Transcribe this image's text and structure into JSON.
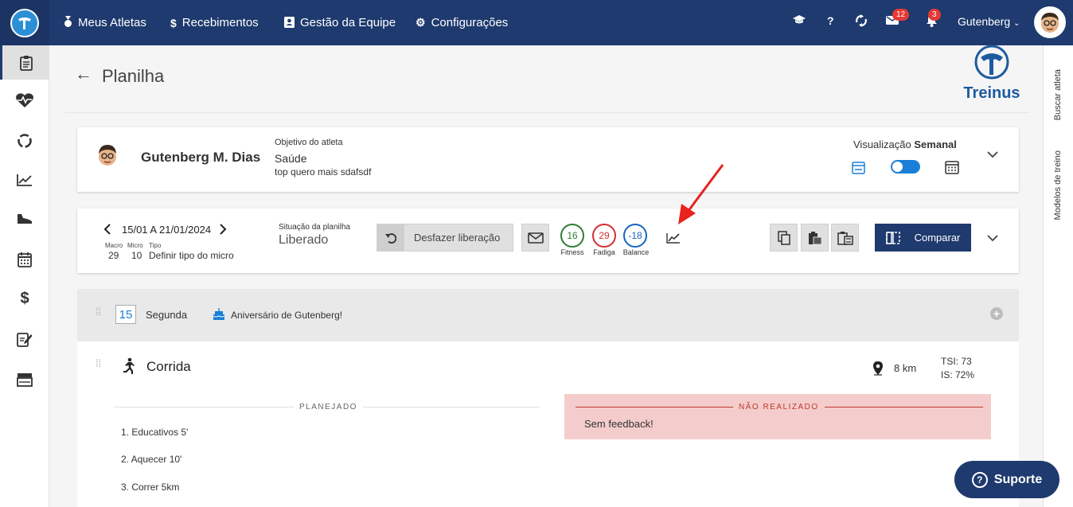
{
  "nav": {
    "items": [
      {
        "icon": "medal-icon",
        "glyph": "♁",
        "label": "Meus Atletas"
      },
      {
        "icon": "dollar-icon",
        "glyph": "$",
        "label": "Recebimentos"
      },
      {
        "icon": "contact-card-icon",
        "glyph": "▣",
        "label": "Gestão da Equipe"
      },
      {
        "icon": "gears-icon",
        "glyph": "⚙",
        "label": "Configurações"
      }
    ],
    "messages_badge": "12",
    "notifications_badge": "3",
    "user_name": "Gutenberg",
    "accent": "#1e3a6e"
  },
  "right_sidebar": {
    "search_athlete": "Buscar atleta",
    "training_models": "Modelos de treino"
  },
  "page": {
    "title": "Planilha",
    "brand": "Treinus"
  },
  "athlete": {
    "name": "Gutenberg M. Dias",
    "objective_label": "Objetivo do atleta",
    "objective": "Saúde",
    "objective_detail": "top quero mais sdafsdf",
    "view_label": "Visualização",
    "view_value": "Semanal"
  },
  "plan": {
    "date_range": "15/01 A 21/01/2024",
    "macro_label": "Macro",
    "micro_label": "Micro",
    "tipo_label": "Tipo",
    "macro": "29",
    "micro": "10",
    "tipo": "Definir tipo do micro",
    "status_label": "Situação da planilha",
    "status": "Liberado",
    "undo_button": "Desfazer liberação",
    "metrics": [
      {
        "value": "16",
        "label": "Fitness",
        "color": "#2e7d32"
      },
      {
        "value": "29",
        "label": "Fadiga",
        "color": "#d32f2f"
      },
      {
        "value": "-18",
        "label": "Balance",
        "color": "#1565c0"
      }
    ],
    "compare_button": "Comparar"
  },
  "day": {
    "number": "15",
    "weekday": "Segunda",
    "birthday": "Aniversário de Gutenberg!"
  },
  "workout": {
    "title": "Corrida",
    "distance": "8 km",
    "tsi": "TSI: 73",
    "is": "IS: 72%",
    "planned_label": "PLANEJADO",
    "steps": [
      "1. Educativos 5'",
      "2. Aquecer 10'",
      "3. Correr 5km"
    ],
    "not_done_label": "NÃO REALIZADO",
    "feedback": "Sem feedback!"
  },
  "support_button": "Suporte"
}
